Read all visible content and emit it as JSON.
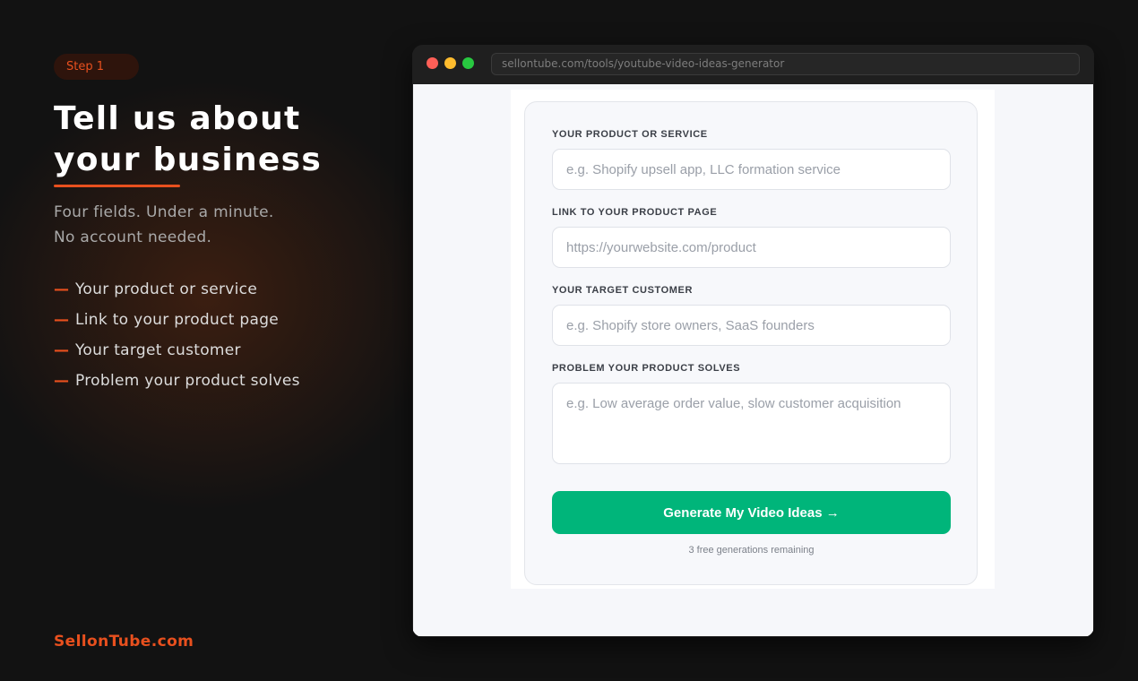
{
  "left_panel": {
    "step_badge": "Step 1",
    "headline_line1": "Tell us about",
    "headline_line2": "your business",
    "subtext_line1": "Four fields. Under a minute.",
    "subtext_line2": "No account needed.",
    "fields": [
      {
        "dash": "—",
        "label": "Your product or service"
      },
      {
        "dash": "—",
        "label": "Link to your product page"
      },
      {
        "dash": "—",
        "label": "Your target customer"
      },
      {
        "dash": "—",
        "label": "Problem your product solves"
      }
    ],
    "brand": "SellonTube.com"
  },
  "browser": {
    "url": "sellontube.com/tools/youtube-video-ideas-generator"
  },
  "form": {
    "product_label": "YOUR PRODUCT OR SERVICE",
    "product_placeholder": "e.g. Shopify upsell app, LLC formation service",
    "product_value": "",
    "link_label": "LINK TO YOUR PRODUCT PAGE",
    "link_placeholder": "https://yourwebsite.com/product",
    "link_value": "",
    "customer_label": "YOUR TARGET CUSTOMER",
    "customer_placeholder": "e.g. Shopify store owners, SaaS founders",
    "customer_value": "",
    "problem_label": "PROBLEM YOUR PRODUCT SOLVES",
    "problem_placeholder": "e.g. Low average order value, slow customer acquisition",
    "problem_value": "",
    "submit_label": "Generate My Video Ideas →",
    "remaining_text": "3 free generations remaining"
  },
  "colors": {
    "accent": "#e8501e",
    "button": "#00b57a",
    "background": "#121212"
  }
}
